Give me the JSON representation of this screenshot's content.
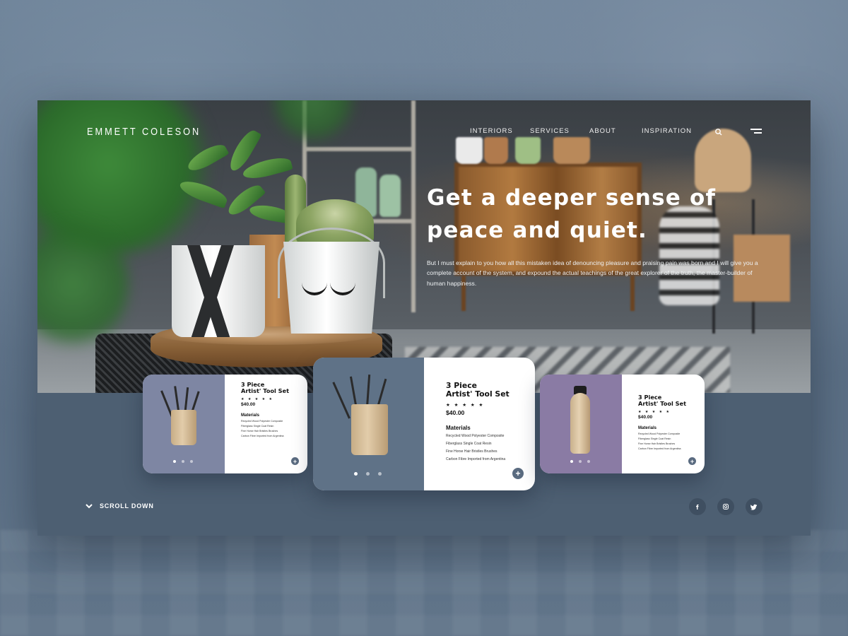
{
  "brand": {
    "name": "EMMETT COLESON"
  },
  "nav": {
    "items": [
      "INTERIORS",
      "SERVICES",
      "ABOUT",
      "INSPIRATION"
    ]
  },
  "icons": {
    "search": "search-icon",
    "menu": "menu-icon",
    "scroll": "chevron-down-icon",
    "add": "plus-icon",
    "facebook": "facebook-icon",
    "instagram": "instagram-icon",
    "twitter": "twitter-icon"
  },
  "hero": {
    "title_line1": "Get a deeper sense of",
    "title_line2": "peace and quiet.",
    "text": "But I must explain to you how all this mistaken idea of denouncing pleasure and praising pain was born and I will give you a complete account of the system, and expound the actual teachings of the great explorer of the truth, the master-builder of human happiness."
  },
  "cards": [
    {
      "title_line1": "3 Piece",
      "title_line2": "Artist' Tool Set",
      "stars": "★ ★ ★ ★ ★",
      "price": "$40.00",
      "materials_label": "Materials",
      "materials": [
        "Recycled Wood Polyester Composite",
        "Fiberglass Single Coat Resin",
        "Fine Horse Hair Bristles Brushes",
        "Carbon Fibre Imported from Argentina"
      ],
      "slide_count": 3,
      "active_slide": 0,
      "image_bg": "#7e86a3",
      "plus": "+"
    },
    {
      "title_line1": "3 Piece",
      "title_line2": "Artist' Tool Set",
      "stars": "★ ★ ★ ★ ★",
      "price": "$40.00",
      "materials_label": "Materials",
      "materials": [
        "Recycled Wood Polyester Composite",
        "Fiberglass Single Coat Resin",
        "Fine Horse Hair Bristles Brushes",
        "Carbon Fibre Imported from Argentina"
      ],
      "slide_count": 3,
      "active_slide": 0,
      "image_bg": "#5f7287",
      "plus": "+"
    },
    {
      "title_line1": "3 Piece",
      "title_line2": "Artist' Tool Set",
      "stars": "★ ★ ★ ★ ★",
      "price": "$40.00",
      "materials_label": "Materials",
      "materials": [
        "Recycled Wood Polyester Composite",
        "Fiberglass Single Coat Resin",
        "Fine Horse Hair Bristles Brushes",
        "Carbon Fibre Imported from Argentina"
      ],
      "slide_count": 3,
      "active_slide": 0,
      "image_bg": "#8a7ba4",
      "plus": "+"
    }
  ],
  "footer": {
    "scroll_label": "SCROLL DOWN"
  },
  "colors": {
    "page_bg": "#5d7186",
    "panel_bg": "#4d5f72",
    "accent": "#5a6b80"
  }
}
